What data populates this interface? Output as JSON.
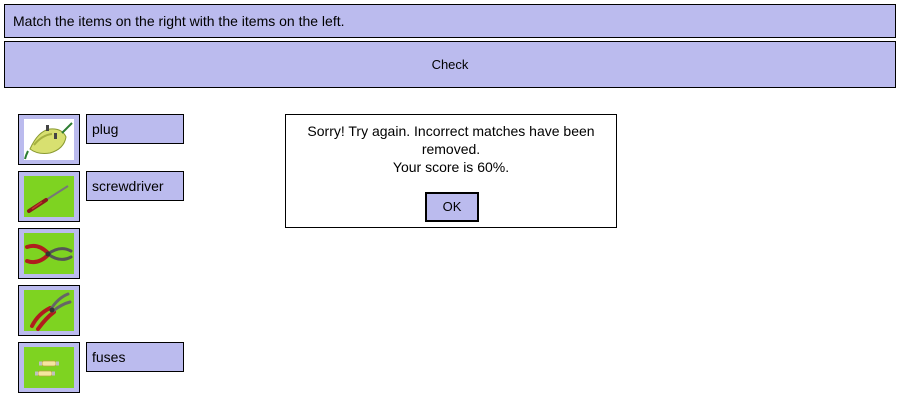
{
  "instructions": "Match the items on the right with the items on the left.",
  "check_label": "Check",
  "items": [
    {
      "icon": "plug-photo-icon",
      "label": "plug"
    },
    {
      "icon": "screwdriver-photo-icon",
      "label": "screwdriver"
    },
    {
      "icon": "pliers-photo-icon",
      "label": ""
    },
    {
      "icon": "wire-stripper-photo-icon",
      "label": ""
    },
    {
      "icon": "fuses-photo-icon",
      "label": "fuses"
    }
  ],
  "dialog": {
    "line1": "Sorry! Try again. Incorrect matches have been",
    "line2": "removed.",
    "line3": "Your score is 60%.",
    "ok_label": "OK"
  },
  "score_percent": 60,
  "colors": {
    "panel": "#bbbbee",
    "photo_background": "#7ed321",
    "border": "#000000"
  }
}
